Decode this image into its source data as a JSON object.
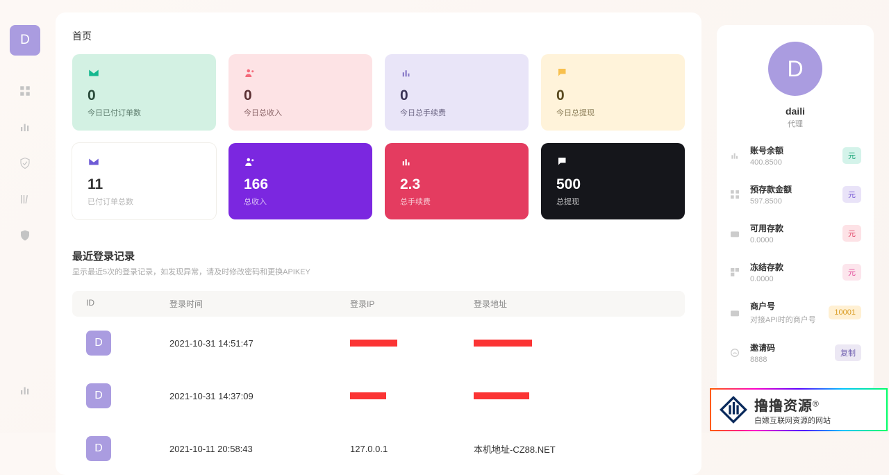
{
  "logo_letter": "D",
  "page_title": "首页",
  "stats_top": [
    {
      "value": "0",
      "label": "今日已付订单数"
    },
    {
      "value": "0",
      "label": "今日总收入"
    },
    {
      "value": "0",
      "label": "今日总手续费"
    },
    {
      "value": "0",
      "label": "今日总提现"
    }
  ],
  "stats_bottom": [
    {
      "value": "11",
      "label": "已付订单总数"
    },
    {
      "value": "166",
      "label": "总收入"
    },
    {
      "value": "2.3",
      "label": "总手续费"
    },
    {
      "value": "500",
      "label": "总提现"
    }
  ],
  "login_section": {
    "title": "最近登录记录",
    "subtitle": "显示最近5次的登录记录，如发现异常，请及时修改密码和更换APIKEY",
    "headers": {
      "id": "ID",
      "time": "登录时间",
      "ip": "登录IP",
      "addr": "登录地址"
    },
    "rows": [
      {
        "avatar_letter": "D",
        "time": "2021-10-31 14:51:47",
        "ip_redacted": true,
        "ip_redact_w": 68,
        "addr_redacted": true,
        "addr_redact_w": 84
      },
      {
        "avatar_letter": "D",
        "time": "2021-10-31 14:37:09",
        "ip_redacted": true,
        "ip_redact_w": 52,
        "addr_redacted": true,
        "addr_redact_w": 80
      },
      {
        "avatar_letter": "D",
        "time": "2021-10-11 20:58:43",
        "ip": "127.0.0.1",
        "addr": "本机地址-CZ88.NET"
      }
    ]
  },
  "profile": {
    "avatar_letter": "D",
    "name": "daili",
    "role": "代理",
    "items": [
      {
        "title": "账号余额",
        "value": "400.8500",
        "badge": "元",
        "badge_class": "badge-teal"
      },
      {
        "title": "预存款金额",
        "value": "597.8500",
        "badge": "元",
        "badge_class": "badge-lav"
      },
      {
        "title": "可用存款",
        "value": "0.0000",
        "badge": "元",
        "badge_class": "badge-pink"
      },
      {
        "title": "冻结存款",
        "value": "0.0000",
        "badge": "元",
        "badge_class": "badge-pink2"
      },
      {
        "title": "商户号",
        "value": "对接API时的商户号",
        "badge": "10001",
        "badge_class": "badge-amber"
      },
      {
        "title": "邀请码",
        "value": "8888",
        "badge": "复制",
        "badge_class": "badge-gray"
      }
    ]
  },
  "watermark": {
    "brand": "撸撸资源",
    "tagline": "白嫖互联网资源的网站"
  }
}
